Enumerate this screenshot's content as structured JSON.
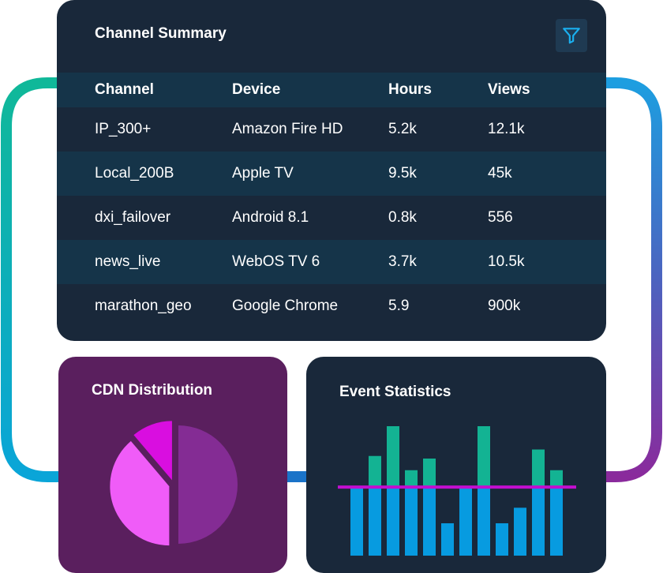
{
  "summary": {
    "title": "Channel Summary",
    "columns": [
      "Channel",
      "Device",
      "Hours",
      "Views"
    ],
    "rows": [
      [
        "IP_300+",
        "Amazon Fire HD",
        "5.2k",
        "12.1k"
      ],
      [
        "Local_200B",
        "Apple TV",
        "9.5k",
        "45k"
      ],
      [
        "dxi_failover",
        "Android 8.1",
        "0.8k",
        "556"
      ],
      [
        "news_live",
        "WebOS TV 6",
        "3.7k",
        "10.5k"
      ],
      [
        "marathon_geo",
        "Google Chrome",
        "5.9",
        "900k"
      ]
    ],
    "filter_icon": "filter-icon"
  },
  "cdn": {
    "title": "CDN Distribution",
    "slices": [
      {
        "fraction": 0.5,
        "color": "#842c94"
      },
      {
        "fraction": 0.388,
        "color": "#f05cf8"
      },
      {
        "fraction": 0.112,
        "color": "#d90ee0"
      }
    ]
  },
  "events": {
    "title": "Event Statistics",
    "bars": [
      {
        "total": 0.53,
        "top": 0
      },
      {
        "total": 0.77,
        "top": 0.25
      },
      {
        "total": 1.0,
        "top": 0.48
      },
      {
        "total": 0.66,
        "top": 0.13
      },
      {
        "total": 0.75,
        "top": 0.22
      },
      {
        "total": 0.25,
        "top": 0
      },
      {
        "total": 0.53,
        "top": 0
      },
      {
        "total": 1.0,
        "top": 0.48
      },
      {
        "total": 0.25,
        "top": 0
      },
      {
        "total": 0.37,
        "top": 0
      },
      {
        "total": 0.82,
        "top": 0.29
      },
      {
        "total": 0.66,
        "top": 0.13
      }
    ],
    "baseline": 0.53,
    "colors": {
      "bar": "#079be0",
      "top": "#13b393",
      "line": "#c20fcf"
    }
  },
  "colors": {
    "frame_start": "#10b899",
    "frame_end": "#8a2a9c"
  }
}
